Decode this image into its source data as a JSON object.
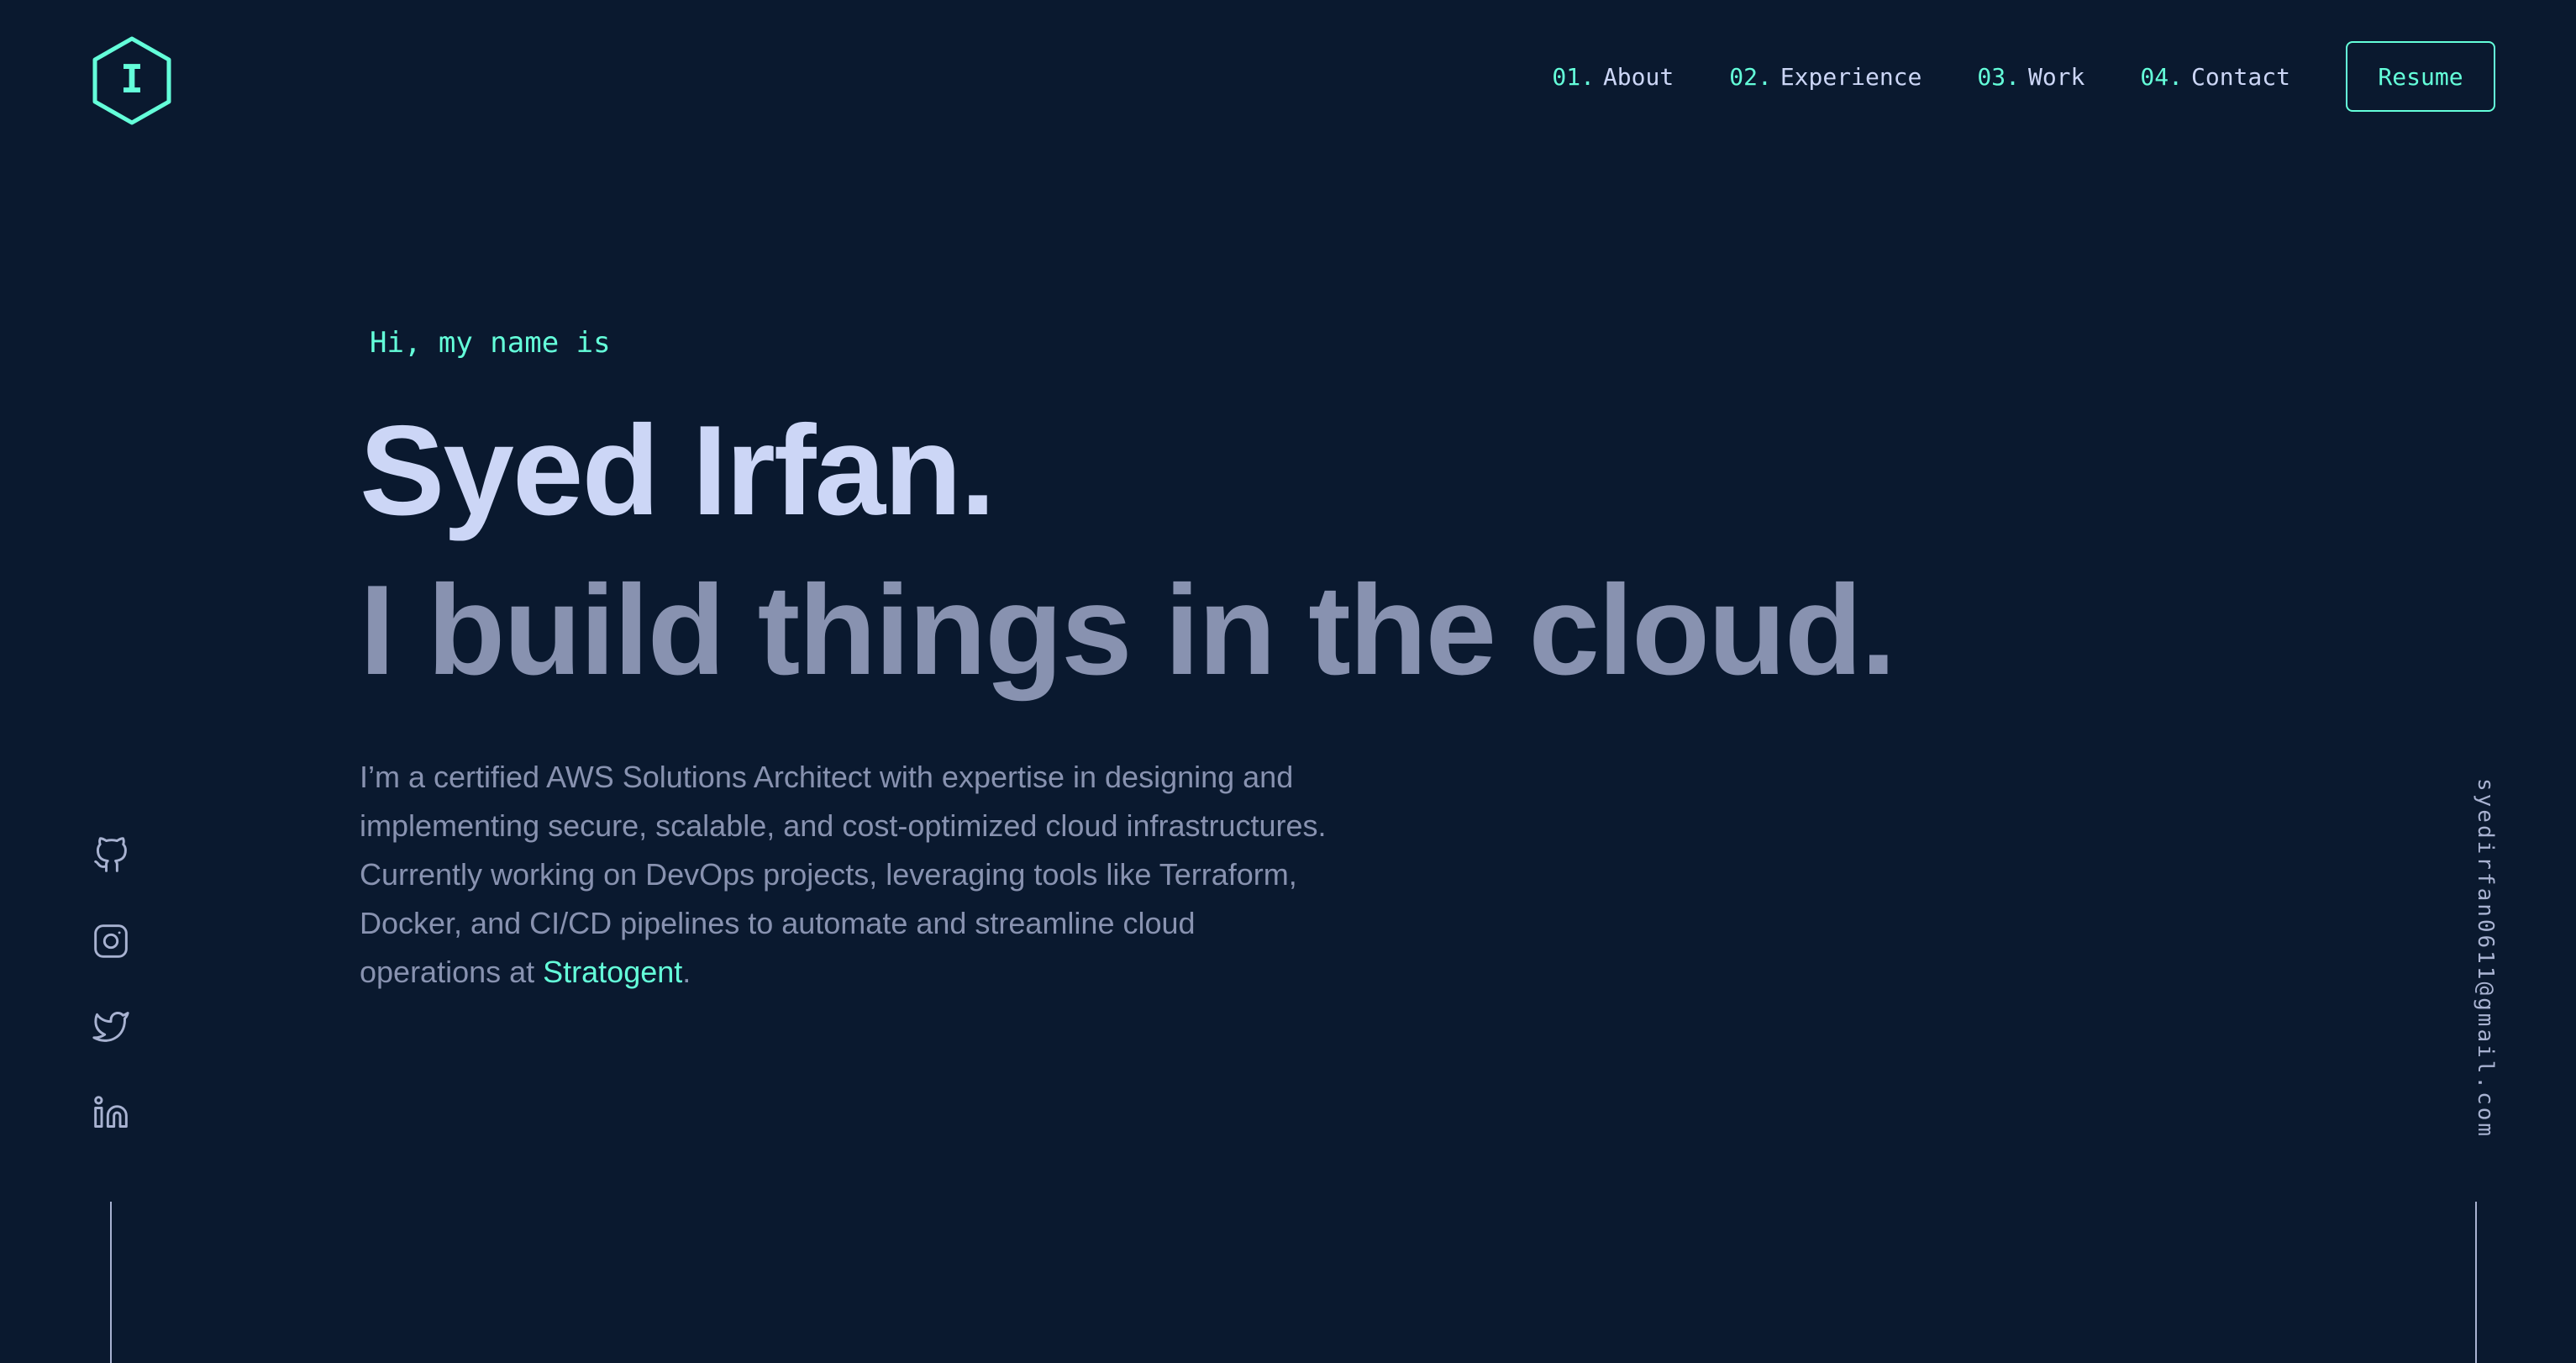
{
  "header": {
    "logo_letter": "I",
    "nav": [
      {
        "num": "01.",
        "label": "About"
      },
      {
        "num": "02.",
        "label": "Experience"
      },
      {
        "num": "03.",
        "label": "Work"
      },
      {
        "num": "04.",
        "label": "Contact"
      }
    ],
    "resume_label": "Resume"
  },
  "hero": {
    "greeting": "Hi, my name is",
    "name": "Syed Irfan.",
    "tagline": "I build things in the cloud.",
    "intro_text": "I’m a certified AWS Solutions Architect with expertise in designing and implementing secure, scalable, and cost-optimized cloud infrastructures. Currently working on DevOps projects, leveraging tools like Terraform, Docker, and CI/CD pipelines to automate and streamline cloud operations at ",
    "company": "Stratogent",
    "intro_end": "."
  },
  "social": {
    "icons": [
      "github-icon",
      "instagram-icon",
      "twitter-icon",
      "linkedin-icon"
    ]
  },
  "email": "syedirfan0611@gmail.com",
  "colors": {
    "background": "#0a192f",
    "accent": "#64ffda",
    "heading": "#ccd6f6",
    "body_text": "#8892b0",
    "light_slate": "#a8b2d1"
  }
}
